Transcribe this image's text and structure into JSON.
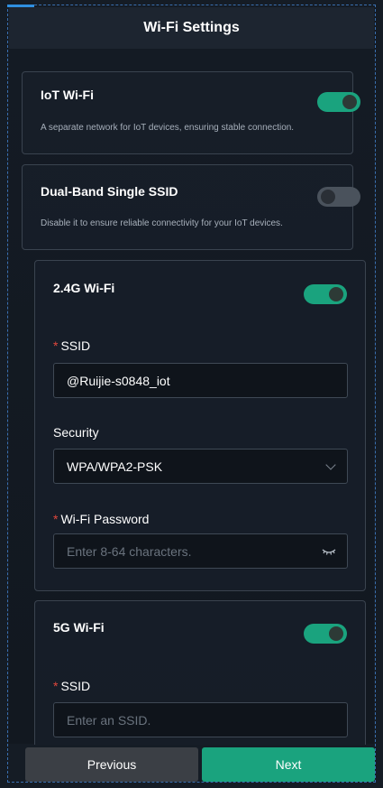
{
  "header": {
    "title": "Wi-Fi Settings"
  },
  "iot": {
    "title": "IoT Wi-Fi",
    "description": "A separate network for IoT devices, ensuring stable connection.",
    "enabled": true
  },
  "dual_band": {
    "title": "Dual-Band Single SSID",
    "description": "Disable it to ensure reliable connectivity for your IoT devices.",
    "enabled": false
  },
  "band_24": {
    "title": "2.4G Wi-Fi",
    "enabled": true,
    "required_mark": "*",
    "ssid_label": "SSID",
    "ssid_value": "@Ruijie-s0848_iot",
    "security_label": "Security",
    "security_value": "WPA/WPA2-PSK",
    "password_label": "Wi-Fi Password",
    "password_placeholder": "Enter 8-64 characters."
  },
  "band_5": {
    "title": "5G Wi-Fi",
    "enabled": true,
    "required_mark": "*",
    "ssid_label": "SSID",
    "ssid_placeholder": "Enter an SSID."
  },
  "footer": {
    "previous_label": "Previous",
    "next_label": "Next"
  },
  "colors": {
    "accent": "#1aa37e",
    "required": "#e0473c",
    "background": "#151c25"
  }
}
